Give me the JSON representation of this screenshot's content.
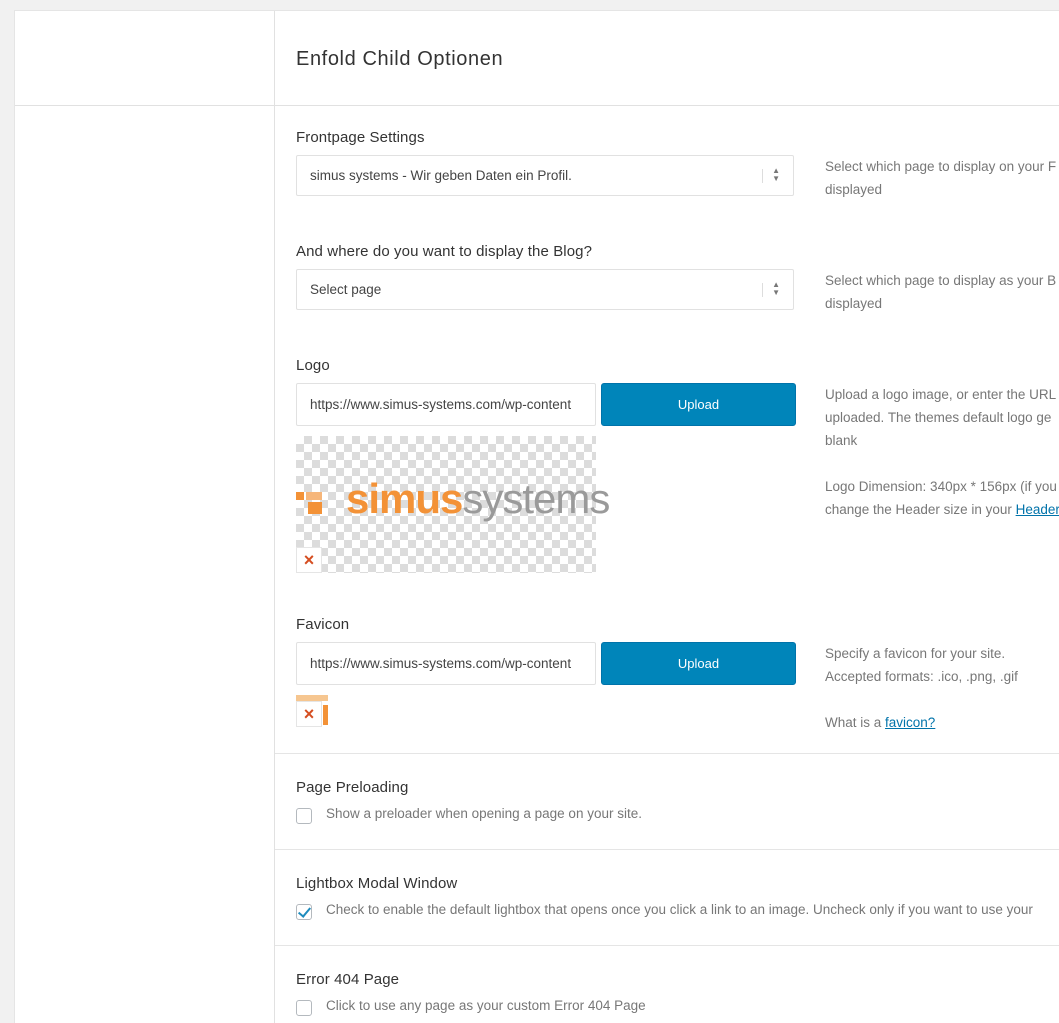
{
  "page": {
    "title": "Enfold Child Optionen"
  },
  "frontpage": {
    "label": "Frontpage Settings",
    "selected": "simus systems - Wir geben Daten ein Profil.",
    "desc_line1": "Select which page to display on your F",
    "desc_line2": "displayed"
  },
  "blog": {
    "label": "And where do you want to display the Blog?",
    "selected": "Select page",
    "desc_line1": "Select which page to display as your B",
    "desc_line2": "displayed"
  },
  "logo": {
    "label": "Logo",
    "url": "https://www.simus-systems.com/wp-content",
    "upload_label": "Upload",
    "brand_simus": "simus",
    "brand_systems": "systems",
    "remove_glyph": "×",
    "desc_line1": "Upload a logo image, or enter the URL",
    "desc_line2": "uploaded. The themes default logo ge",
    "desc_line3": "blank",
    "desc_line4": "Logo Dimension: 340px * 156px (if you",
    "desc_line5_prefix": "change the Header size in your ",
    "desc_line5_link": "Header"
  },
  "favicon": {
    "label": "Favicon",
    "url": "https://www.simus-systems.com/wp-content",
    "upload_label": "Upload",
    "remove_glyph": "×",
    "desc_line1": "Specify a favicon for your site.",
    "desc_line2": "Accepted formats: .ico, .png, .gif",
    "desc_line3_prefix": "What is a ",
    "desc_line3_link": "favicon?"
  },
  "preloading": {
    "label": "Page Preloading",
    "checked": false,
    "text": "Show a preloader when opening a page on your site."
  },
  "lightbox": {
    "label": "Lightbox Modal Window",
    "checked": true,
    "text": "Check to enable the default lightbox that opens once you click a link to an image. Uncheck only if you want to use your"
  },
  "error404": {
    "label": "Error 404 Page",
    "checked": false,
    "text": "Click to use any page as your custom Error 404 Page"
  },
  "colors": {
    "upload_button": "#0085ba",
    "remove_x": "#d54e21",
    "brand_orange": "#f39237",
    "brand_gray": "#9a9a9a"
  }
}
